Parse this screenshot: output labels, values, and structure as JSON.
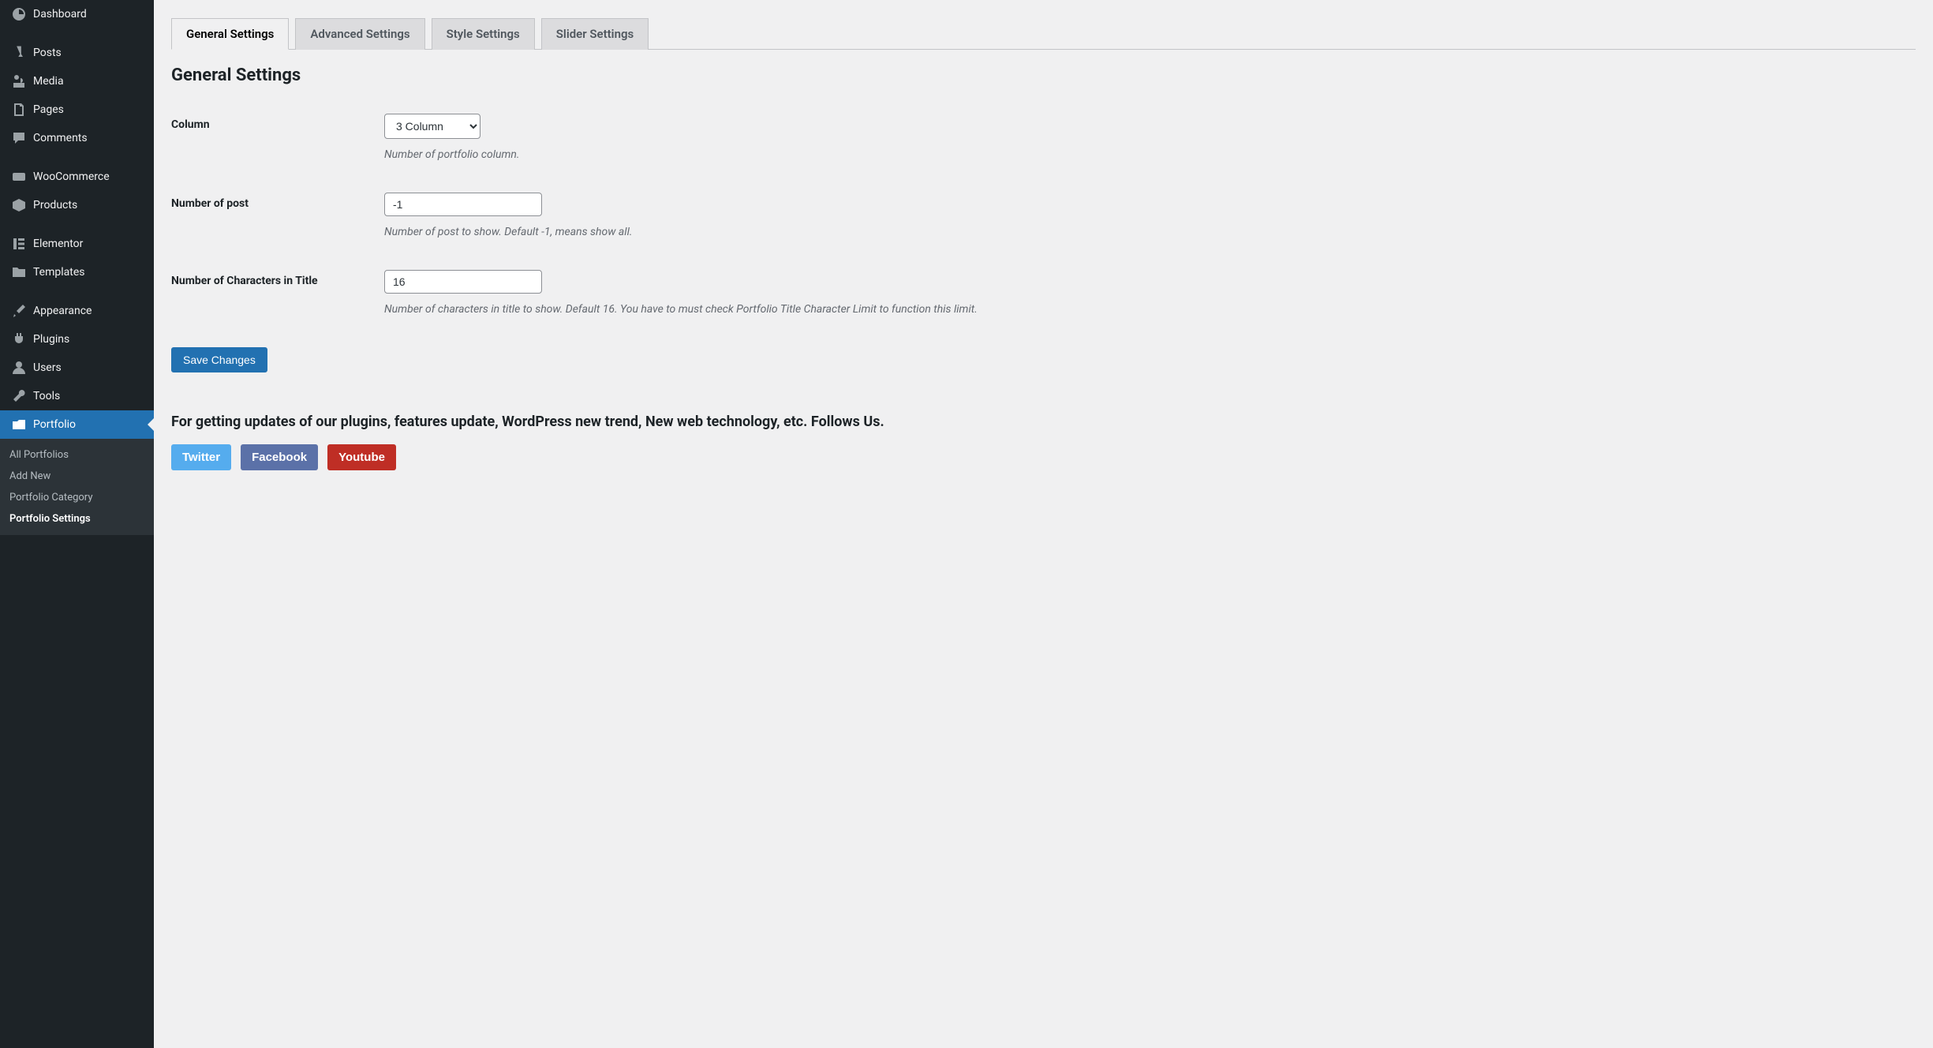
{
  "sidebar": {
    "items": [
      {
        "label": "Dashboard"
      },
      {
        "label": "Posts"
      },
      {
        "label": "Media"
      },
      {
        "label": "Pages"
      },
      {
        "label": "Comments"
      },
      {
        "label": "WooCommerce"
      },
      {
        "label": "Products"
      },
      {
        "label": "Elementor"
      },
      {
        "label": "Templates"
      },
      {
        "label": "Appearance"
      },
      {
        "label": "Plugins"
      },
      {
        "label": "Users"
      },
      {
        "label": "Tools"
      },
      {
        "label": "Portfolio"
      }
    ],
    "submenu": [
      {
        "label": "All Portfolios"
      },
      {
        "label": "Add New"
      },
      {
        "label": "Portfolio Category"
      },
      {
        "label": "Portfolio Settings"
      }
    ]
  },
  "tabs": [
    {
      "label": "General Settings"
    },
    {
      "label": "Advanced Settings"
    },
    {
      "label": "Style Settings"
    },
    {
      "label": "Slider Settings"
    }
  ],
  "heading": "General Settings",
  "form": {
    "column": {
      "label": "Column",
      "value": "3 Column",
      "hint": "Number of portfolio column."
    },
    "posts": {
      "label": "Number of post",
      "value": "-1",
      "hint": "Number of post to show. Default -1, means show all."
    },
    "chars": {
      "label": "Number of Characters in Title",
      "value": "16",
      "hint": "Number of characters in title to show. Default 16. You have to must check Portfolio Title Character Limit to function this limit."
    },
    "save": "Save Changes"
  },
  "follow": {
    "heading": "For getting updates of our plugins, features update, WordPress new trend, New web technology, etc. Follows Us.",
    "twitter": "Twitter",
    "facebook": "Facebook",
    "youtube": "Youtube"
  }
}
